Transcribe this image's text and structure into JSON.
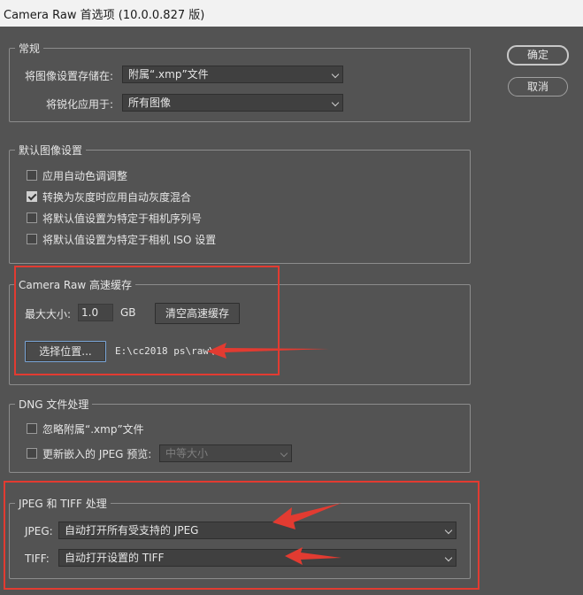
{
  "window": {
    "title": "Camera Raw 首选项 (10.0.0.827 版)"
  },
  "buttons": {
    "ok": "确定",
    "cancel": "取消"
  },
  "general": {
    "legend": "常规",
    "save_settings_label": "将图像设置存储在:",
    "save_settings_value": "附属“.xmp”文件",
    "sharpen_label": "将锐化应用于:",
    "sharpen_value": "所有图像"
  },
  "defaults": {
    "legend": "默认图像设置",
    "items": [
      {
        "label": "应用自动色调调整",
        "checked": false
      },
      {
        "label": "转换为灰度时应用自动灰度混合",
        "checked": true
      },
      {
        "label": "将默认值设置为特定于相机序列号",
        "checked": false
      },
      {
        "label": "将默认值设置为特定于相机 ISO 设置",
        "checked": false
      }
    ]
  },
  "cache": {
    "legend": "Camera Raw 高速缓存",
    "max_size_label": "最大大小:",
    "max_size_value": "1.0",
    "unit": "GB",
    "purge_button": "清空高速缓存",
    "select_location_button": "选择位置...",
    "location_path": "E:\\cc2018 ps\\raw\\"
  },
  "dng": {
    "legend": "DNG 文件处理",
    "ignore_sidecar_label": "忽略附属“.xmp”文件",
    "ignore_sidecar_checked": false,
    "update_preview_label": "更新嵌入的 JPEG 预览:",
    "update_preview_checked": false,
    "preview_size_value": "中等大小"
  },
  "jpeg_tiff": {
    "legend": "JPEG 和 TIFF 处理",
    "jpeg_label": "JPEG:",
    "jpeg_value": "自动打开所有受支持的 JPEG",
    "tiff_label": "TIFF:",
    "tiff_value": "自动打开设置的 TIFF"
  },
  "annotation_color": "#e23b31"
}
